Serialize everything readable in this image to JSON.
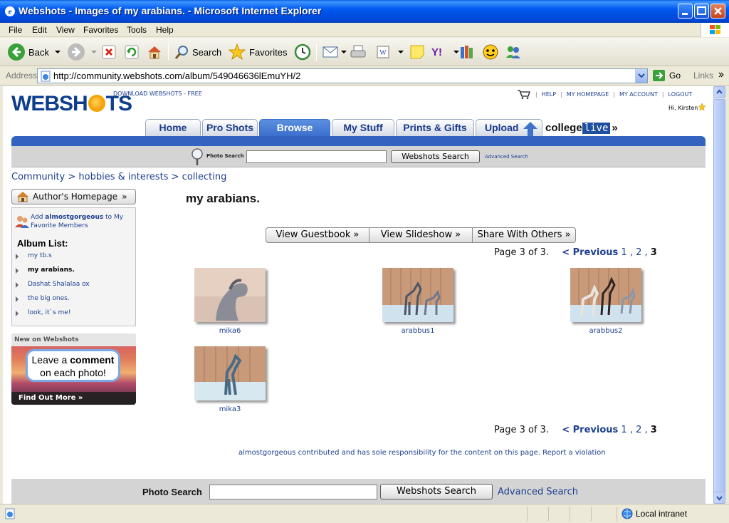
{
  "window": {
    "title": "Webshots - Images of my arabians. - Microsoft Internet Explorer"
  },
  "menu": [
    "File",
    "Edit",
    "View",
    "Favorites",
    "Tools",
    "Help"
  ],
  "toolbar": {
    "back": "Back",
    "search": "Search",
    "favorites": "Favorites"
  },
  "address": {
    "label": "Address",
    "url": "http://community.webshots.com/album/549046636lEmuYH/2",
    "go": "Go",
    "links": "Links"
  },
  "header": {
    "logo": "WEBSHOTS",
    "download": "DOWNLOAD WEBSHOTS - FREE",
    "links": [
      "HELP",
      "MY HOMEPAGE",
      "MY ACCOUNT",
      "LOGOUT"
    ],
    "greeting": "Hi, Kirsten"
  },
  "tabs": [
    "Home",
    "Pro Shots",
    "Browse",
    "My Stuff",
    "Prints & Gifts",
    "Upload"
  ],
  "college": {
    "left": "college",
    "right": "live",
    "arrow": "»"
  },
  "top_search": {
    "label": "Photo Search",
    "value": "",
    "button": "Webshots Search",
    "advanced": "Advanced Search"
  },
  "breadcrumb": "Community > hobbies & interests > collecting",
  "sidebar": {
    "author_button": "Author's Homepage",
    "add_fav_prefix": "Add ",
    "add_fav_user": "almostgorgeous",
    "add_fav_suffix": " to My Favorite Members",
    "album_list_title": "Album List:",
    "albums": [
      {
        "label": "my tb.s",
        "current": false
      },
      {
        "label": "my arabians.",
        "current": true
      },
      {
        "label": "Dashat Shalalaa ox",
        "current": false
      },
      {
        "label": "the big ones.",
        "current": false
      },
      {
        "label": "look, it`s me!",
        "current": false
      }
    ],
    "promo": {
      "header": "New on Webshots",
      "line1": "Leave a ",
      "line1_bold": "comment",
      "line2": "on each photo!",
      "cta": "Find Out More »"
    }
  },
  "album": {
    "title": "my arabians.",
    "actions": [
      "View Guestbook »",
      "View Slideshow »",
      "Share With Others »"
    ],
    "pager": {
      "text": "Page 3 of 3.",
      "previous": "< Previous",
      "pages": [
        "1",
        "2",
        "3"
      ],
      "sep": ","
    },
    "photos": [
      {
        "caption": "mika6"
      },
      {
        "caption": "arabbus1"
      },
      {
        "caption": "arabbus2"
      },
      {
        "caption": "mika3"
      }
    ],
    "responsibility_user": "almostgorgeous",
    "responsibility_text": " contributed and has sole responsibility for the content on this page. ",
    "report": "Report a violation"
  },
  "bottom_search": {
    "label": "Photo Search",
    "value": "",
    "button": "Webshots Search",
    "advanced": "Advanced Search"
  },
  "status": {
    "zone": "Local intranet"
  }
}
